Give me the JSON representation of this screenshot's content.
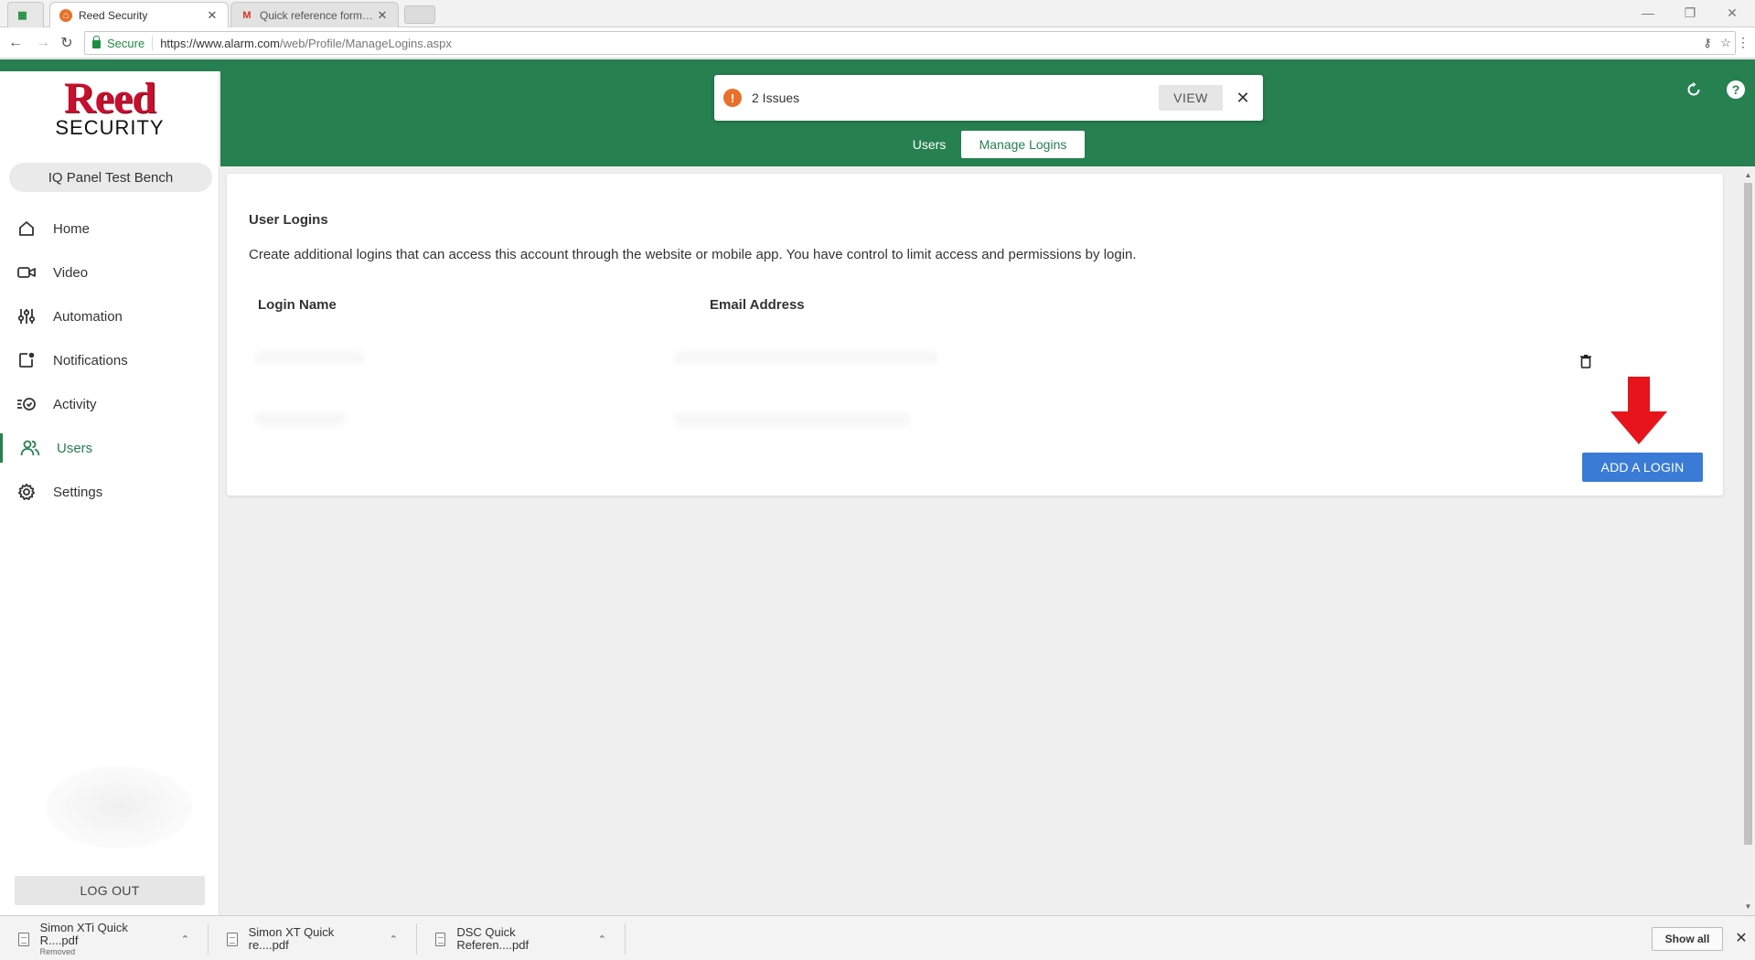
{
  "browser": {
    "tabs": [
      {
        "title": "Reed Security",
        "favicon": "reed-favicon",
        "active": true
      },
      {
        "title": "Quick reference form - c",
        "favicon": "gmail-favicon",
        "active": false
      }
    ],
    "secure_label": "Secure",
    "url_host": "https://www.alarm.com",
    "url_path": "/web/Profile/ManageLogins.aspx"
  },
  "brand": {
    "logo_line1": "Reed",
    "logo_line2": "SECURITY",
    "accent": "#268050",
    "logo_red": "#c8102e"
  },
  "sidebar": {
    "account_name": "IQ Panel Test Bench",
    "items": [
      {
        "label": "Home",
        "icon": "home-icon"
      },
      {
        "label": "Video",
        "icon": "video-camera-icon"
      },
      {
        "label": "Automation",
        "icon": "sliders-icon"
      },
      {
        "label": "Notifications",
        "icon": "notification-icon"
      },
      {
        "label": "Activity",
        "icon": "activity-icon"
      },
      {
        "label": "Users",
        "icon": "users-icon",
        "active": true
      },
      {
        "label": "Settings",
        "icon": "gear-icon"
      }
    ],
    "logout_label": "LOG OUT"
  },
  "header": {
    "issues_text": "2 Issues",
    "view_label": "VIEW",
    "issue_color": "#e8702a",
    "tabs": [
      {
        "label": "Users",
        "active": false
      },
      {
        "label": "Manage Logins",
        "active": true
      }
    ]
  },
  "main": {
    "title": "User Logins",
    "description": "Create additional logins that can access this account through the website or mobile app. You have control to limit access and permissions by login.",
    "columns": [
      "Login Name",
      "Email Address"
    ],
    "add_button_label": "ADD A LOGIN",
    "add_button_color": "#3a7bd5",
    "annotation_arrow_color": "#e8141c"
  },
  "downloads": {
    "items": [
      {
        "name": "Simon XTi Quick R....pdf",
        "status": "Removed"
      },
      {
        "name": "Simon XT Quick re....pdf",
        "status": ""
      },
      {
        "name": "DSC Quick Referen....pdf",
        "status": ""
      }
    ],
    "show_all_label": "Show all"
  }
}
